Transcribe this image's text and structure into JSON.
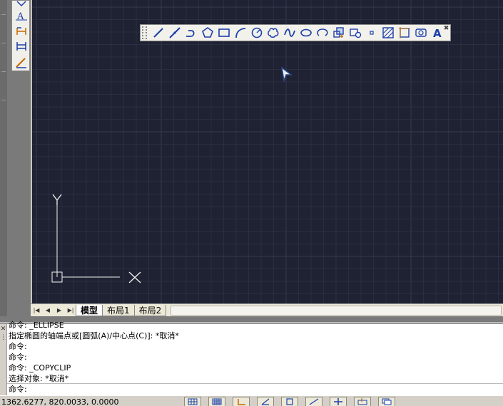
{
  "layout_tabs": {
    "model": "模型",
    "layout1": "布局1",
    "layout2": "布局2"
  },
  "ucs": {
    "y_label": "Y"
  },
  "command_history": [
    "命令: _ELLIPSE",
    "指定椭圆的轴端点或[圆弧(A)/中心点(C)]: *取消*",
    "命令:",
    "命令:",
    "命令: _COPYCLIP",
    "选择对象: *取消*"
  ],
  "command_prompt": "命令:",
  "status": {
    "coordinates": "1362.6277, 820.0033, 0.0000"
  },
  "toolbar_icons": [
    "line-icon",
    "construction-line-icon",
    "polyline-icon",
    "polygon-icon",
    "rectangle-icon",
    "arc-icon",
    "circle-icon",
    "revision-cloud-icon",
    "spline-icon",
    "ellipse-icon",
    "ellipse-arc-icon",
    "insert-block-icon",
    "make-block-icon",
    "point-icon",
    "hatch-icon",
    "gradient-icon",
    "region-icon",
    "multiline-text-icon"
  ],
  "colors": {
    "canvas_background": "#1f2232",
    "grid_minor": "#2a2e40",
    "grid_major": "#353a50",
    "icon_blue": "#1c3fa8"
  }
}
